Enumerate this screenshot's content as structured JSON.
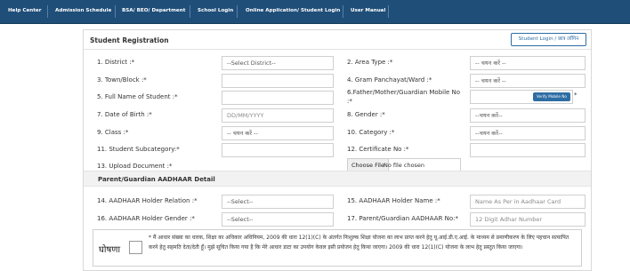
{
  "nav": {
    "items": [
      "Help Center",
      "Admission Schedule",
      "BSA/ BEO/ Department",
      "School Login",
      "Online Application/ Student Login",
      "User Manual"
    ]
  },
  "form": {
    "title": "Student Registration",
    "login_button": "Student Login / छात्र लॉगिन",
    "fields": {
      "district": {
        "label": "1. District :*",
        "value": "--Select District--"
      },
      "area_type": {
        "label": "2. Area Type :*",
        "value": "-- चयन करें --"
      },
      "town_block": {
        "label": "3. Town/Block :*",
        "value": ""
      },
      "gram_panchayat": {
        "label": "4. Gram Panchayat/Ward :*",
        "value": "-- चयन करें --"
      },
      "full_name": {
        "label": "5. Full Name of Student :*",
        "value": ""
      },
      "mobile": {
        "label_line1": "6.Father/Mother/Guardian Mobile No",
        "label_line2": ":*",
        "value": "",
        "verify_label": "Verify Mobile No",
        "star": "*"
      },
      "dob": {
        "label": "7. Date of Birth :*",
        "placeholder": "DD/MM/YYYY"
      },
      "gender": {
        "label": "8. Gender :*",
        "value": "--चयन करें--"
      },
      "class": {
        "label": "9. Class :*",
        "value": "-- चयन करें --"
      },
      "category": {
        "label": "10. Category :*",
        "value": "--चयन करें--"
      },
      "subcategory": {
        "label": "11. Student Subcategory:*",
        "value": ""
      },
      "certificate": {
        "label": "12. Certificate No :*",
        "value": ""
      },
      "upload": {
        "label": "13. Upload Document :*",
        "button": "Choose File",
        "status": "No file chosen"
      }
    },
    "aadhaar_section": {
      "title": "Parent/Guardian AADHAAR Detail",
      "relation": {
        "label": "14. AADHAAR Holder Relation :*",
        "value": "--Select--"
      },
      "holder_name": {
        "label": "15. AADHAAR Holder Name :*",
        "placeholder": "Name As Per in Aadhaar Card"
      },
      "holder_gender": {
        "label": "16. AADHAAR Holder Gender :*",
        "value": "--Select--"
      },
      "aadhaar_no": {
        "label": "17. Parent/Guardian AADHAAR No:*",
        "placeholder": "12 Digit Adhar Number"
      }
    },
    "declaration": {
      "word": "घोषणा",
      "text": "* मैं आधार संख्या का धारक, शिक्षा का अधिकार अधिनियम, 2009 की धारा 12(1)(C) के अंतर्गत निःशुल्क शिक्षा योजना का लाभ प्राप्त करने हेतु यू.आई.डी.ए.आई. के माध्यम से प्रमाणीकरण के लिए पहचान सत्यापित करने हेतु सहमति देता/देती हूँ। मुझे सूचित किया गया है कि मेरे आधार डाटा का उपयोग केवल इसी प्रयोजन हेतु किया जाएगा। 2009 की धारा 12(1)(C) योजना के लाभ हेतु प्रस्तुत किया जाएगा।"
    }
  }
}
